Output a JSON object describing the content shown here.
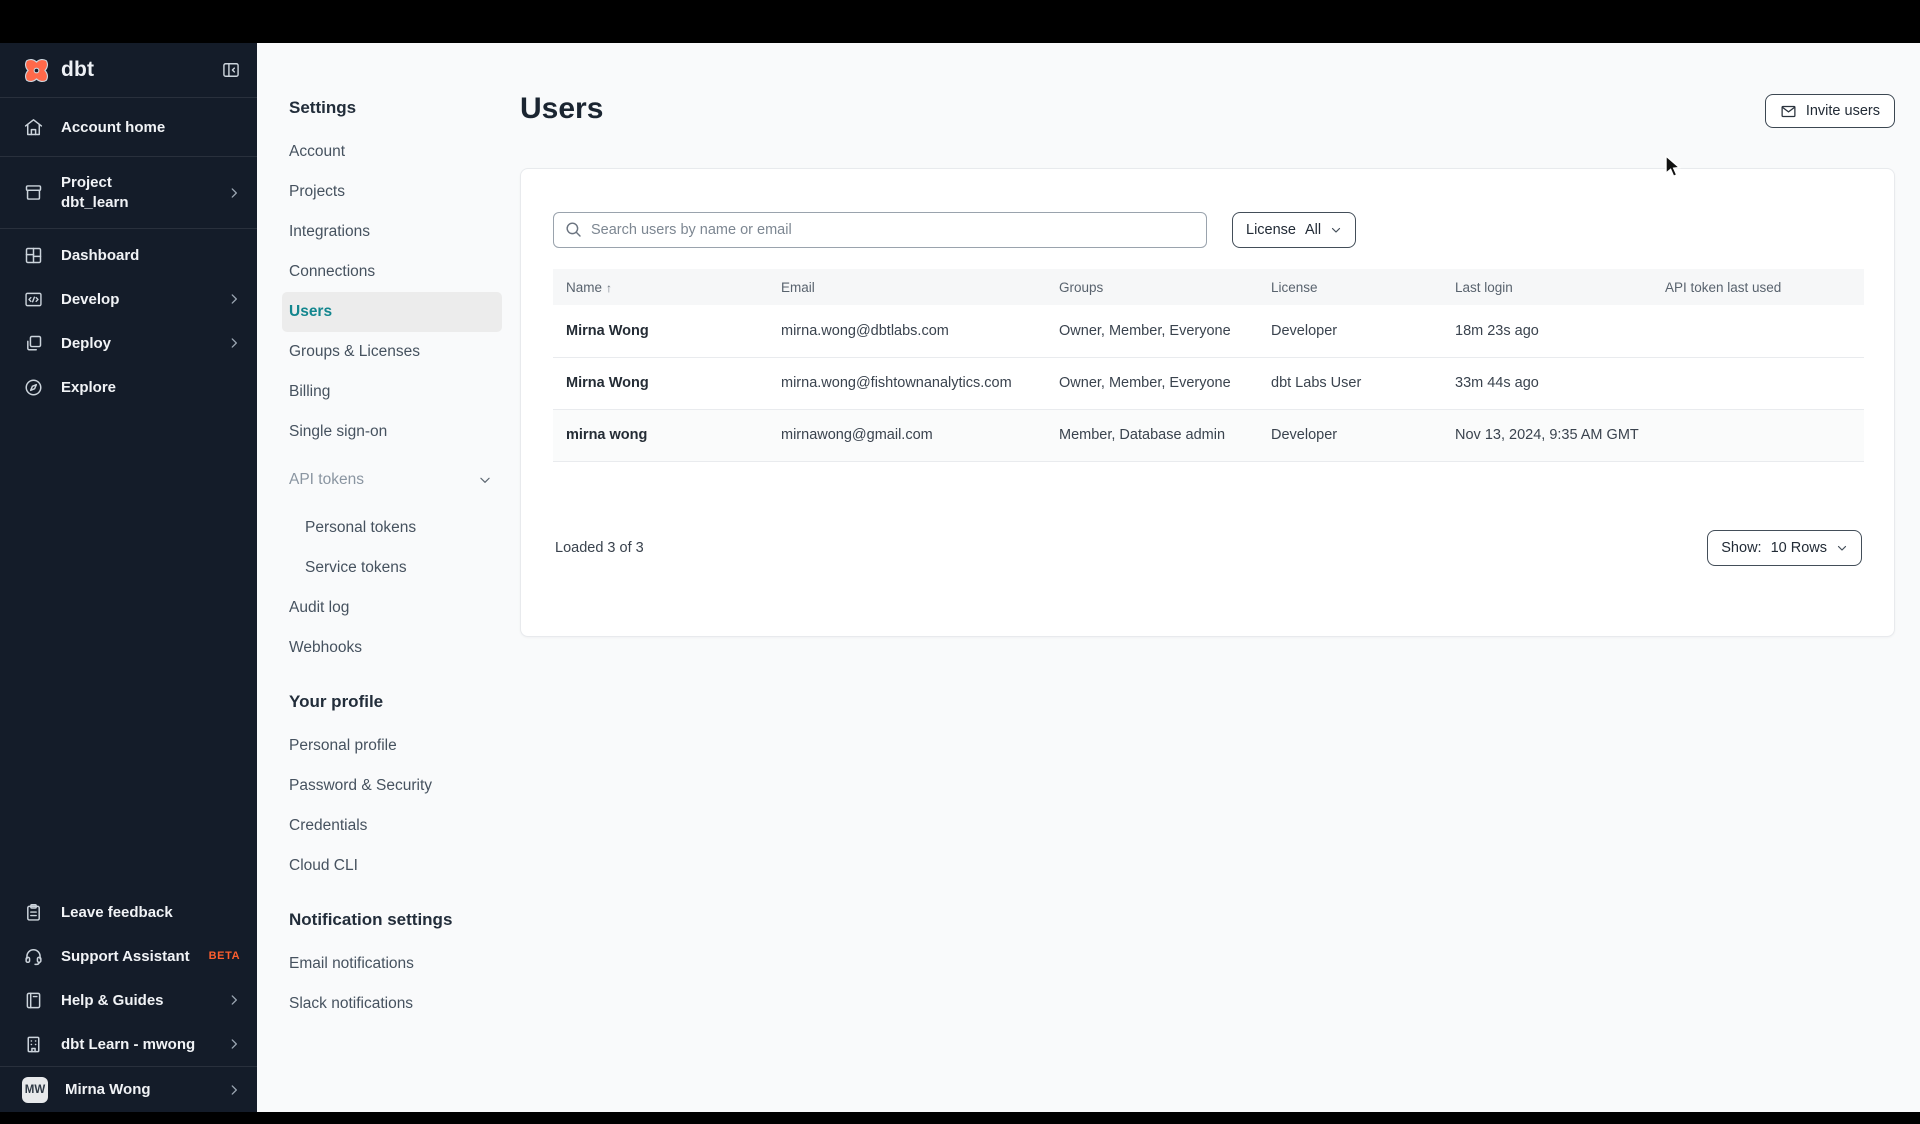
{
  "colors": {
    "brand_orange": "#ff694a",
    "active_teal": "#13868e",
    "beta_badge": "#fc5e2e",
    "sidebar_bg": "#141c29"
  },
  "sidebar": {
    "brand": "dbt",
    "items": [
      {
        "label": "Account home"
      },
      {
        "label": "Project",
        "sublabel": "dbt_learn"
      },
      {
        "label": "Dashboard"
      },
      {
        "label": "Develop"
      },
      {
        "label": "Deploy"
      },
      {
        "label": "Explore"
      }
    ],
    "footer_items": [
      {
        "label": "Leave feedback"
      },
      {
        "label": "Support Assistant",
        "badge": "BETA"
      },
      {
        "label": "Help & Guides"
      },
      {
        "label": "dbt Learn - mwong"
      }
    ],
    "user": {
      "name": "Mirna Wong",
      "initials": "MW"
    }
  },
  "settings_nav": {
    "title": "Settings",
    "items": [
      "Account",
      "Projects",
      "Integrations",
      "Connections",
      "Users",
      "Groups & Licenses",
      "Billing",
      "Single sign-on"
    ],
    "active_item": "Users",
    "api_tokens": {
      "label": "API tokens",
      "children": [
        "Personal tokens",
        "Service tokens"
      ]
    },
    "extra_items": [
      "Audit log",
      "Webhooks"
    ],
    "profile_section": {
      "title": "Your profile",
      "items": [
        "Personal profile",
        "Password & Security",
        "Credentials",
        "Cloud CLI"
      ]
    },
    "notifications_section": {
      "title": "Notification settings",
      "items": [
        "Email notifications",
        "Slack notifications"
      ]
    }
  },
  "main": {
    "title": "Users",
    "invite_button": "Invite users",
    "search_placeholder": "Search users by name or email",
    "license_filter": {
      "label": "License",
      "value": "All"
    },
    "table": {
      "headers": [
        "Name",
        "Email",
        "Groups",
        "License",
        "Last login",
        "API token last used"
      ],
      "sort_indicator": "↑",
      "rows": [
        {
          "name": "Mirna Wong",
          "email": "mirna.wong@dbtlabs.com",
          "groups": "Owner, Member, Everyone",
          "license": "Developer",
          "last_login": "18m 23s ago",
          "api_token_last_used": ""
        },
        {
          "name": "Mirna Wong",
          "email": "mirna.wong@fishtownanalytics.com",
          "groups": "Owner, Member, Everyone",
          "license": "dbt Labs User",
          "last_login": "33m 44s ago",
          "api_token_last_used": ""
        },
        {
          "name": "mirna wong",
          "email": "mirnawong@gmail.com",
          "groups": "Member, Database admin",
          "license": "Developer",
          "last_login": "Nov 13, 2024, 9:35 AM GMT",
          "api_token_last_used": ""
        }
      ]
    },
    "footer": {
      "loaded": "Loaded 3 of 3",
      "show_label": "Show:",
      "show_value": "10 Rows"
    }
  }
}
